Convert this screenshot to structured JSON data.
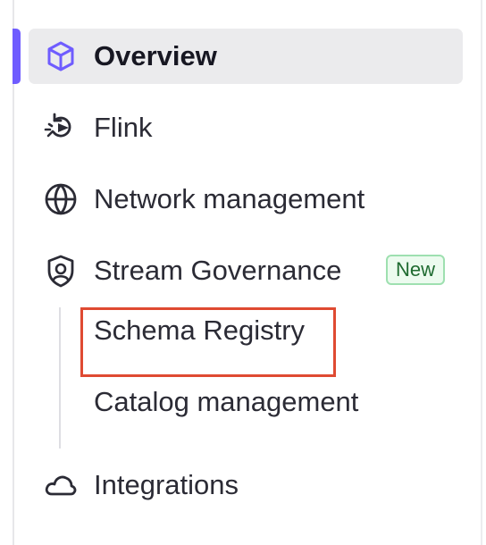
{
  "nav": {
    "items": [
      {
        "id": "overview",
        "label": "Overview",
        "icon": "cube-icon",
        "active": true
      },
      {
        "id": "flink",
        "label": "Flink",
        "icon": "flink-icon",
        "active": false
      },
      {
        "id": "network",
        "label": "Network management",
        "icon": "globe-icon",
        "active": false
      },
      {
        "id": "stream-governance",
        "label": "Stream Governance",
        "icon": "shield-icon",
        "active": false,
        "badge": "New"
      },
      {
        "id": "integrations",
        "label": "Integrations",
        "icon": "cloud-icon",
        "active": false
      }
    ],
    "subitems": [
      {
        "id": "schema-registry",
        "label": "Schema Registry",
        "highlighted": true
      },
      {
        "id": "catalog-management",
        "label": "Catalog management",
        "highlighted": false
      }
    ]
  },
  "colors": {
    "accent": "#6f5cff",
    "active_background": "#ebebed",
    "badge_background": "#ecfbef",
    "badge_border": "#9ee0b0",
    "badge_text": "#1f6b31",
    "highlight_border": "#df4a32",
    "text": "#2b2b35"
  }
}
